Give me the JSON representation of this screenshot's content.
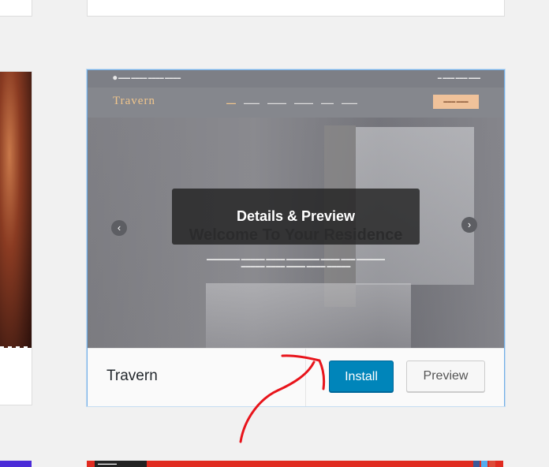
{
  "theme_card": {
    "name": "Travern",
    "overlay_label": "Details & Preview",
    "install_label": "Install",
    "preview_label": "Preview"
  },
  "screenshot": {
    "logo": "Travern",
    "hero_title": "Welcome To Your Residence",
    "prev_arrow": "‹",
    "next_arrow": "›"
  },
  "colors": {
    "install_blue": "#0085ba",
    "annotation_red": "#e8141b",
    "card_border": "#72aee6"
  },
  "icons": [
    "chevron-left-icon",
    "chevron-right-icon",
    "annotation-arrow"
  ]
}
